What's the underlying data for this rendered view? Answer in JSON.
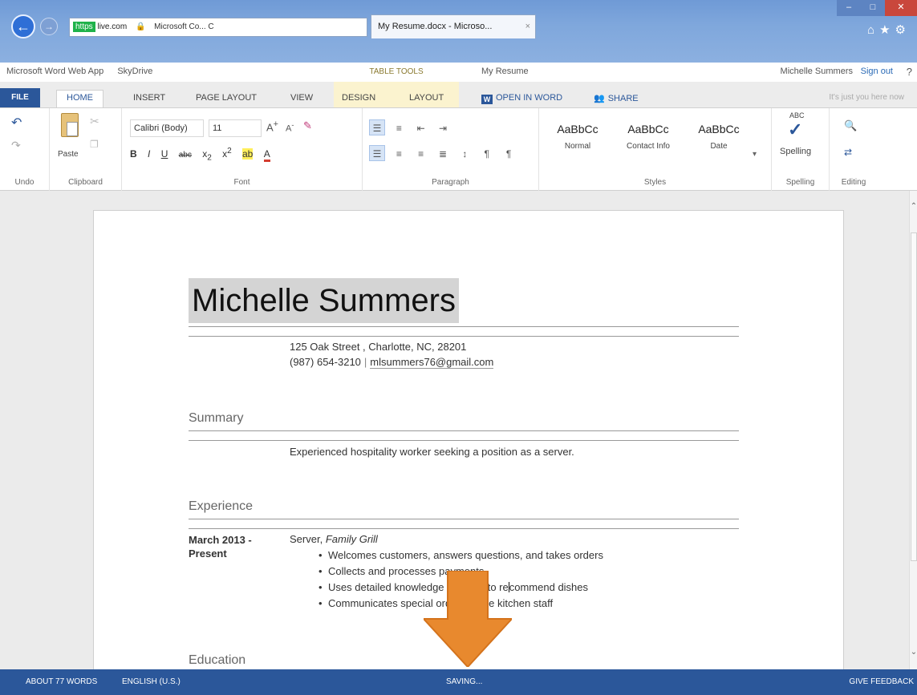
{
  "browser": {
    "https_label": "https",
    "address_site": "live.com",
    "cert_label": "Microsoft Co... C",
    "tab_title": "My Resume.docx - Microso...",
    "tab_close": "×"
  },
  "app_header": {
    "app_name": "Microsoft Word Web App",
    "skydrive": "SkyDrive",
    "table_tools": "TABLE TOOLS",
    "doc_name": "My Resume",
    "user_name": "Michelle Summers",
    "sign_out": "Sign out",
    "help": "?"
  },
  "ribbon_tabs": {
    "file": "FILE",
    "home": "HOME",
    "insert": "INSERT",
    "page_layout": "PAGE LAYOUT",
    "view": "VIEW",
    "design": "DESIGN",
    "layout": "LAYOUT",
    "open_in_word": "OPEN IN WORD",
    "share": "SHARE",
    "presence": "It's just you here now"
  },
  "ribbon": {
    "undo_group": "Undo",
    "clipboard_group": "Clipboard",
    "paste": "Paste",
    "font_group": "Font",
    "font_name": "Calibri (Body)",
    "font_size": "11",
    "paragraph_group": "Paragraph",
    "styles_group": "Styles",
    "styles": [
      {
        "sample": "AaBbCc",
        "name": "Normal"
      },
      {
        "sample": "AaBbCc",
        "name": "Contact Info"
      },
      {
        "sample": "AaBbCc",
        "name": "Date"
      }
    ],
    "spelling_abc": "ABC",
    "spelling_button": "Spelling",
    "spelling_group": "Spelling",
    "editing_group": "Editing"
  },
  "document": {
    "name": "Michelle Summers",
    "address": "125 Oak Street , Charlotte, NC,  28201",
    "phone": "(987) 654-3210",
    "separator": "|",
    "email": "mlsummers76@gmail.com",
    "summary_title": "Summary",
    "summary_text": "Experienced hospitality worker seeking a position as a server.",
    "experience_title": "Experience",
    "exp_date_line1": "March 2013 -",
    "exp_date_line2": "Present",
    "exp_role": "Server,",
    "exp_company": "Family Grill",
    "bullets": [
      "Welcomes customers, answers questions, and takes  orders",
      "Collects and processes payments",
      "Uses detailed knowledge of menu to re",
      "Communicates special orders to the kitchen staff"
    ],
    "bullet3_after_caret": "commend dishes",
    "education_title": "Education"
  },
  "status_bar": {
    "word_count": "ABOUT 77 WORDS",
    "language": "ENGLISH (U.S.)",
    "save_state": "SAVING...",
    "feedback": "GIVE FEEDBACK"
  },
  "colors": {
    "word_blue": "#2b579a",
    "arrow_orange": "#e8892e",
    "table_tools_band": "#fbf3cf"
  }
}
